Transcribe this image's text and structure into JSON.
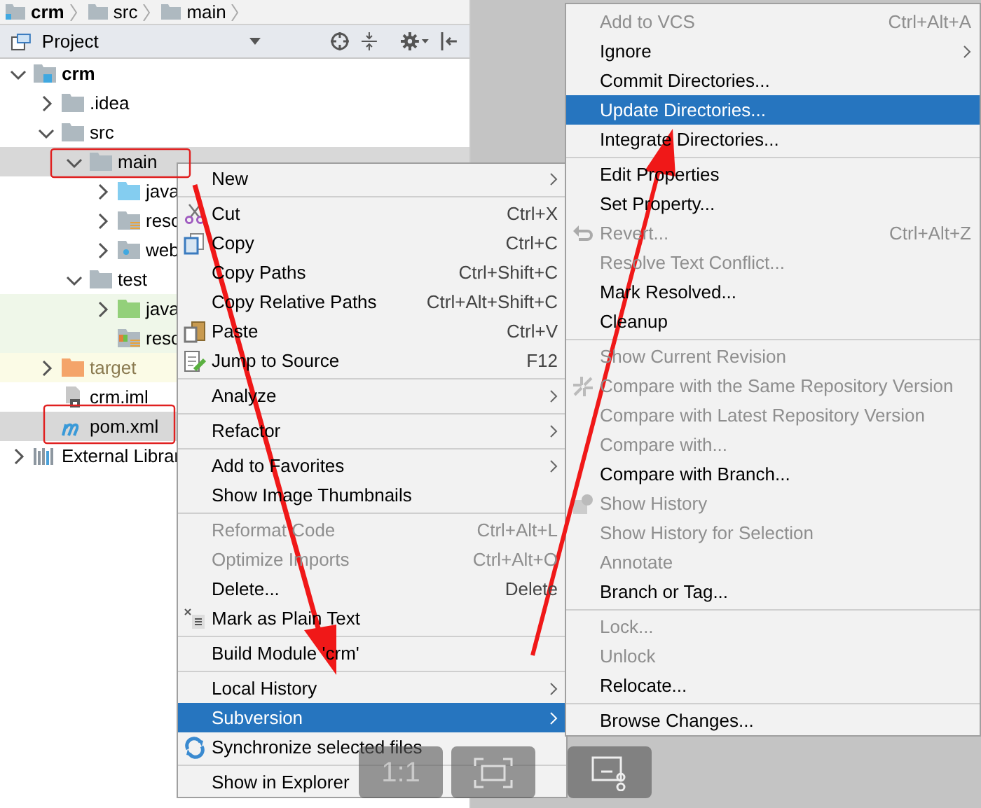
{
  "breadcrumbs": [
    "crm",
    "src",
    "main"
  ],
  "project_panel": {
    "title": "Project"
  },
  "tree": [
    {
      "label": "crm",
      "kind": "module",
      "expanded": true,
      "selected": false,
      "children": [
        {
          "label": ".idea",
          "kind": "folder",
          "expanded": false,
          "selected": false
        },
        {
          "label": "src",
          "kind": "folder",
          "expanded": true,
          "selected": false,
          "children": [
            {
              "label": "main",
              "kind": "folder",
              "expanded": true,
              "selected": true,
              "children": [
                {
                  "label": "java",
                  "kind": "source",
                  "expanded": false,
                  "selected": false
                },
                {
                  "label": "resc",
                  "kind": "resources",
                  "expanded": false,
                  "selected": false
                },
                {
                  "label": "web",
                  "kind": "web",
                  "expanded": false,
                  "selected": false
                }
              ]
            },
            {
              "label": "test",
              "kind": "folder",
              "expanded": true,
              "selected": false,
              "children": [
                {
                  "label": "java",
                  "kind": "test_source",
                  "expanded": false,
                  "selected": false
                },
                {
                  "label": "resc",
                  "kind": "test_resources",
                  "selected": false
                }
              ]
            }
          ]
        },
        {
          "label": "target",
          "kind": "excluded",
          "expanded": false,
          "selected": false
        },
        {
          "label": "crm.iml",
          "kind": "iml",
          "selected": false
        },
        {
          "label": "pom.xml",
          "kind": "maven",
          "selected": true
        }
      ]
    },
    {
      "label": "External Librar",
      "kind": "libraries",
      "expanded": false,
      "selected": false
    }
  ],
  "context_menu": [
    {
      "label": "New",
      "kind": "plain",
      "submenu": true,
      "disabled": false,
      "selected": false,
      "separator_after": true
    },
    {
      "label": "Cut",
      "shortcut": "Ctrl+X",
      "kind": "cut",
      "disabled": false,
      "selected": false
    },
    {
      "label": "Copy",
      "shortcut": "Ctrl+C",
      "kind": "copy",
      "disabled": false,
      "selected": false
    },
    {
      "label": "Copy Paths",
      "shortcut": "Ctrl+Shift+C",
      "kind": "plain",
      "disabled": false,
      "selected": false
    },
    {
      "label": "Copy Relative Paths",
      "shortcut": "Ctrl+Alt+Shift+C",
      "kind": "plain",
      "disabled": false,
      "selected": false
    },
    {
      "label": "Paste",
      "shortcut": "Ctrl+V",
      "kind": "paste",
      "disabled": false,
      "selected": false
    },
    {
      "label": "Jump to Source",
      "shortcut": "F12",
      "kind": "edit",
      "disabled": false,
      "selected": false,
      "separator_after": true
    },
    {
      "label": "Analyze",
      "kind": "plain",
      "submenu": true,
      "disabled": false,
      "selected": false,
      "separator_after": true
    },
    {
      "label": "Refactor",
      "kind": "plain",
      "submenu": true,
      "disabled": false,
      "selected": false,
      "separator_after": true
    },
    {
      "label": "Add to Favorites",
      "kind": "plain",
      "submenu": true,
      "disabled": false,
      "selected": false
    },
    {
      "label": "Show Image Thumbnails",
      "kind": "plain",
      "disabled": false,
      "selected": false,
      "separator_after": true
    },
    {
      "label": "Reformat Code",
      "shortcut": "Ctrl+Alt+L",
      "kind": "plain",
      "disabled": true,
      "selected": false
    },
    {
      "label": "Optimize Imports",
      "shortcut": "Ctrl+Alt+O",
      "kind": "plain",
      "disabled": true,
      "selected": false
    },
    {
      "label": "Delete...",
      "shortcut": "Delete",
      "kind": "plain",
      "disabled": false,
      "selected": false
    },
    {
      "label": "Mark as Plain Text",
      "kind": "plain_text",
      "disabled": false,
      "selected": false,
      "separator_after": true
    },
    {
      "label": "Build Module 'crm'",
      "kind": "plain",
      "disabled": false,
      "selected": false,
      "separator_after": true
    },
    {
      "label": "Local History",
      "kind": "plain",
      "submenu": true,
      "disabled": false,
      "selected": false
    },
    {
      "label": "Subversion",
      "kind": "plain",
      "submenu": true,
      "disabled": false,
      "selected": true
    },
    {
      "label": "Synchronize selected files",
      "kind": "sync",
      "disabled": false,
      "selected": false,
      "separator_after": true
    },
    {
      "label": "Show in Explorer",
      "kind": "plain",
      "disabled": false,
      "selected": false
    }
  ],
  "subversion_menu": [
    {
      "label": "Add to VCS",
      "shortcut": "Ctrl+Alt+A",
      "kind": "plain",
      "disabled": true,
      "selected": false
    },
    {
      "label": "Ignore",
      "kind": "plain",
      "submenu": true,
      "disabled": false,
      "selected": false
    },
    {
      "label": "Commit Directories...",
      "kind": "plain",
      "disabled": false,
      "selected": false
    },
    {
      "label": "Update Directories...",
      "kind": "plain",
      "disabled": false,
      "selected": true
    },
    {
      "label": "Integrate Directories...",
      "kind": "plain",
      "disabled": false,
      "selected": false,
      "separator_after": true
    },
    {
      "label": "Edit Properties",
      "kind": "plain",
      "disabled": false,
      "selected": false
    },
    {
      "label": "Set Property...",
      "kind": "plain",
      "disabled": false,
      "selected": false
    },
    {
      "label": "Revert...",
      "shortcut": "Ctrl+Alt+Z",
      "kind": "revert",
      "disabled": true,
      "selected": false
    },
    {
      "label": "Resolve Text Conflict...",
      "kind": "plain",
      "disabled": true,
      "selected": false
    },
    {
      "label": "Mark Resolved...",
      "kind": "plain",
      "disabled": false,
      "selected": false
    },
    {
      "label": "Cleanup",
      "kind": "plain",
      "disabled": false,
      "selected": false,
      "separator_after": true
    },
    {
      "label": "Show Current Revision",
      "kind": "plain",
      "disabled": true,
      "selected": false
    },
    {
      "label": "Compare with the Same Repository Version",
      "kind": "diff",
      "disabled": true,
      "selected": false
    },
    {
      "label": "Compare with Latest Repository Version",
      "kind": "plain",
      "disabled": true,
      "selected": false
    },
    {
      "label": "Compare with...",
      "kind": "plain",
      "disabled": true,
      "selected": false
    },
    {
      "label": "Compare with Branch...",
      "kind": "plain",
      "disabled": false,
      "selected": false
    },
    {
      "label": "Show History",
      "kind": "history",
      "disabled": true,
      "selected": false
    },
    {
      "label": "Show History for Selection",
      "kind": "plain",
      "disabled": true,
      "selected": false
    },
    {
      "label": "Annotate",
      "kind": "plain",
      "disabled": true,
      "selected": false
    },
    {
      "label": "Branch or Tag...",
      "kind": "plain",
      "disabled": false,
      "selected": false,
      "separator_after": true
    },
    {
      "label": "Lock...",
      "kind": "plain",
      "disabled": true,
      "selected": false
    },
    {
      "label": "Unlock",
      "kind": "plain",
      "disabled": true,
      "selected": false
    },
    {
      "label": "Relocate...",
      "kind": "plain",
      "disabled": false,
      "selected": false,
      "separator_after": true
    },
    {
      "label": "Browse Changes...",
      "kind": "plain",
      "disabled": false,
      "selected": false
    }
  ],
  "capture_toolbar": [
    {
      "kind": "ratio",
      "label": "1:1"
    },
    {
      "kind": "fit"
    },
    {
      "kind": "snip"
    }
  ]
}
